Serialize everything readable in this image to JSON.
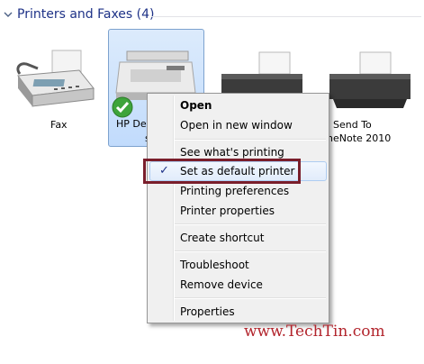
{
  "group": {
    "title": "Printers and Faxes (4)"
  },
  "devices": [
    {
      "label": "Fax",
      "icon": "fax-icon"
    },
    {
      "label": "HP Des",
      "label2": "s",
      "icon": "printer-icon",
      "selected": true,
      "default_badge": "check-icon"
    },
    {
      "label": "",
      "icon": "printer-icon"
    },
    {
      "label": "Send To",
      "label2": "neNote 2010",
      "icon": "printer-icon"
    }
  ],
  "context_menu": {
    "items": [
      {
        "label": "Open",
        "bold": true
      },
      {
        "label": "Open in new window"
      },
      {
        "label": "See what's printing"
      },
      {
        "label": "Set as default printer",
        "checked": true,
        "hover": true
      },
      {
        "label": "Printing preferences"
      },
      {
        "label": "Printer properties"
      },
      {
        "label": "Create shortcut"
      },
      {
        "label": "Troubleshoot"
      },
      {
        "label": "Remove device"
      },
      {
        "label": "Properties"
      }
    ],
    "check_glyph": "✓"
  },
  "watermark": "www.TechTin.com",
  "colors": {
    "header_text": "#1e3287",
    "highlight_border": "#7a1e2b",
    "watermark": "#b2242c",
    "selection": "#c1dbfc"
  }
}
